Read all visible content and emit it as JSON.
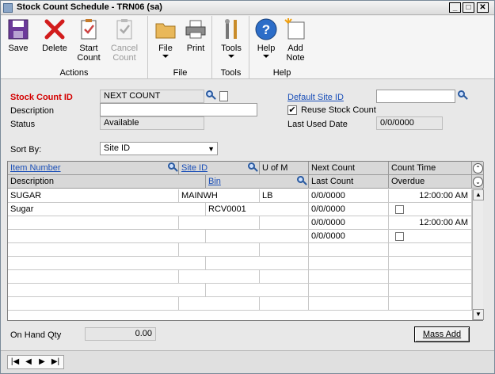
{
  "window": {
    "title": "Stock Count Schedule  -  TRN06 (sa)"
  },
  "ribbon": {
    "save": "Save",
    "delete": "Delete",
    "start_count": "Start\nCount",
    "cancel_count": "Cancel\nCount",
    "actions_group": "Actions",
    "file": "File",
    "print": "Print",
    "file_group": "File",
    "tools": "Tools",
    "tools_group": "Tools",
    "help": "Help",
    "add_note": "Add\nNote",
    "help_group": "Help"
  },
  "form": {
    "stock_count_id_label": "Stock Count ID",
    "stock_count_id_value": "NEXT COUNT",
    "description_label": "Description",
    "description_value": "",
    "status_label": "Status",
    "status_value": "Available",
    "default_site_label": "Default Site ID",
    "default_site_value": "",
    "reuse_label": "Reuse Stock Count",
    "reuse_checked": "✔",
    "last_used_label": "Last Used Date",
    "last_used_value": "0/0/0000",
    "sort_by_label": "Sort By:",
    "sort_by_value": "Site ID"
  },
  "grid": {
    "headers": {
      "item_number": "Item Number",
      "site_id": "Site ID",
      "uom": "U of M",
      "next_count": "Next Count",
      "count_time": "Count Time",
      "description": "Description",
      "bin": "Bin",
      "last_count": "Last Count",
      "overdue": "Overdue"
    },
    "rows": [
      {
        "col1": "SUGAR",
        "col2": "MAINWH",
        "col3": "LB",
        "col4": "0/0/0000",
        "col5": "12:00:00 AM"
      },
      {
        "col1": "Sugar",
        "col2": "RCV0001",
        "col3": "",
        "col4": "0/0/0000",
        "col5": ""
      },
      {
        "col1": "",
        "col2": "",
        "col3": "",
        "col4": "0/0/0000",
        "col5": "12:00:00 AM"
      },
      {
        "col1": "",
        "col2": "",
        "col3": "",
        "col4": "0/0/0000",
        "col5": ""
      }
    ]
  },
  "footer": {
    "on_hand_label": "On Hand Qty",
    "on_hand_value": "0.00",
    "mass_add": "Mass Add"
  }
}
